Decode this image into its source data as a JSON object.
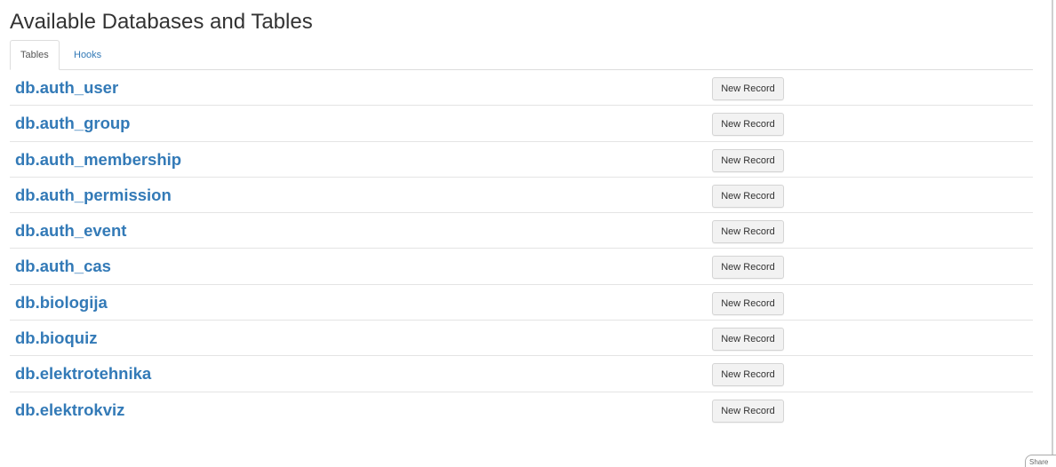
{
  "page": {
    "title": "Available Databases and Tables"
  },
  "tabs": [
    {
      "label": "Tables",
      "active": true
    },
    {
      "label": "Hooks",
      "active": false
    }
  ],
  "tables": [
    {
      "name": "db.auth_user",
      "button_label": "New Record"
    },
    {
      "name": "db.auth_group",
      "button_label": "New Record"
    },
    {
      "name": "db.auth_membership",
      "button_label": "New Record"
    },
    {
      "name": "db.auth_permission",
      "button_label": "New Record"
    },
    {
      "name": "db.auth_event",
      "button_label": "New Record"
    },
    {
      "name": "db.auth_cas",
      "button_label": "New Record"
    },
    {
      "name": "db.biologija",
      "button_label": "New Record"
    },
    {
      "name": "db.bioquiz",
      "button_label": "New Record"
    },
    {
      "name": "db.elektrotehnika",
      "button_label": "New Record"
    },
    {
      "name": "db.elektrokviz",
      "button_label": "New Record"
    }
  ],
  "share": {
    "label": "Share"
  },
  "colors": {
    "link": "#337ab7",
    "text": "#333333",
    "divider": "#e4e4e4",
    "button_bg": "#f2f2f2"
  }
}
